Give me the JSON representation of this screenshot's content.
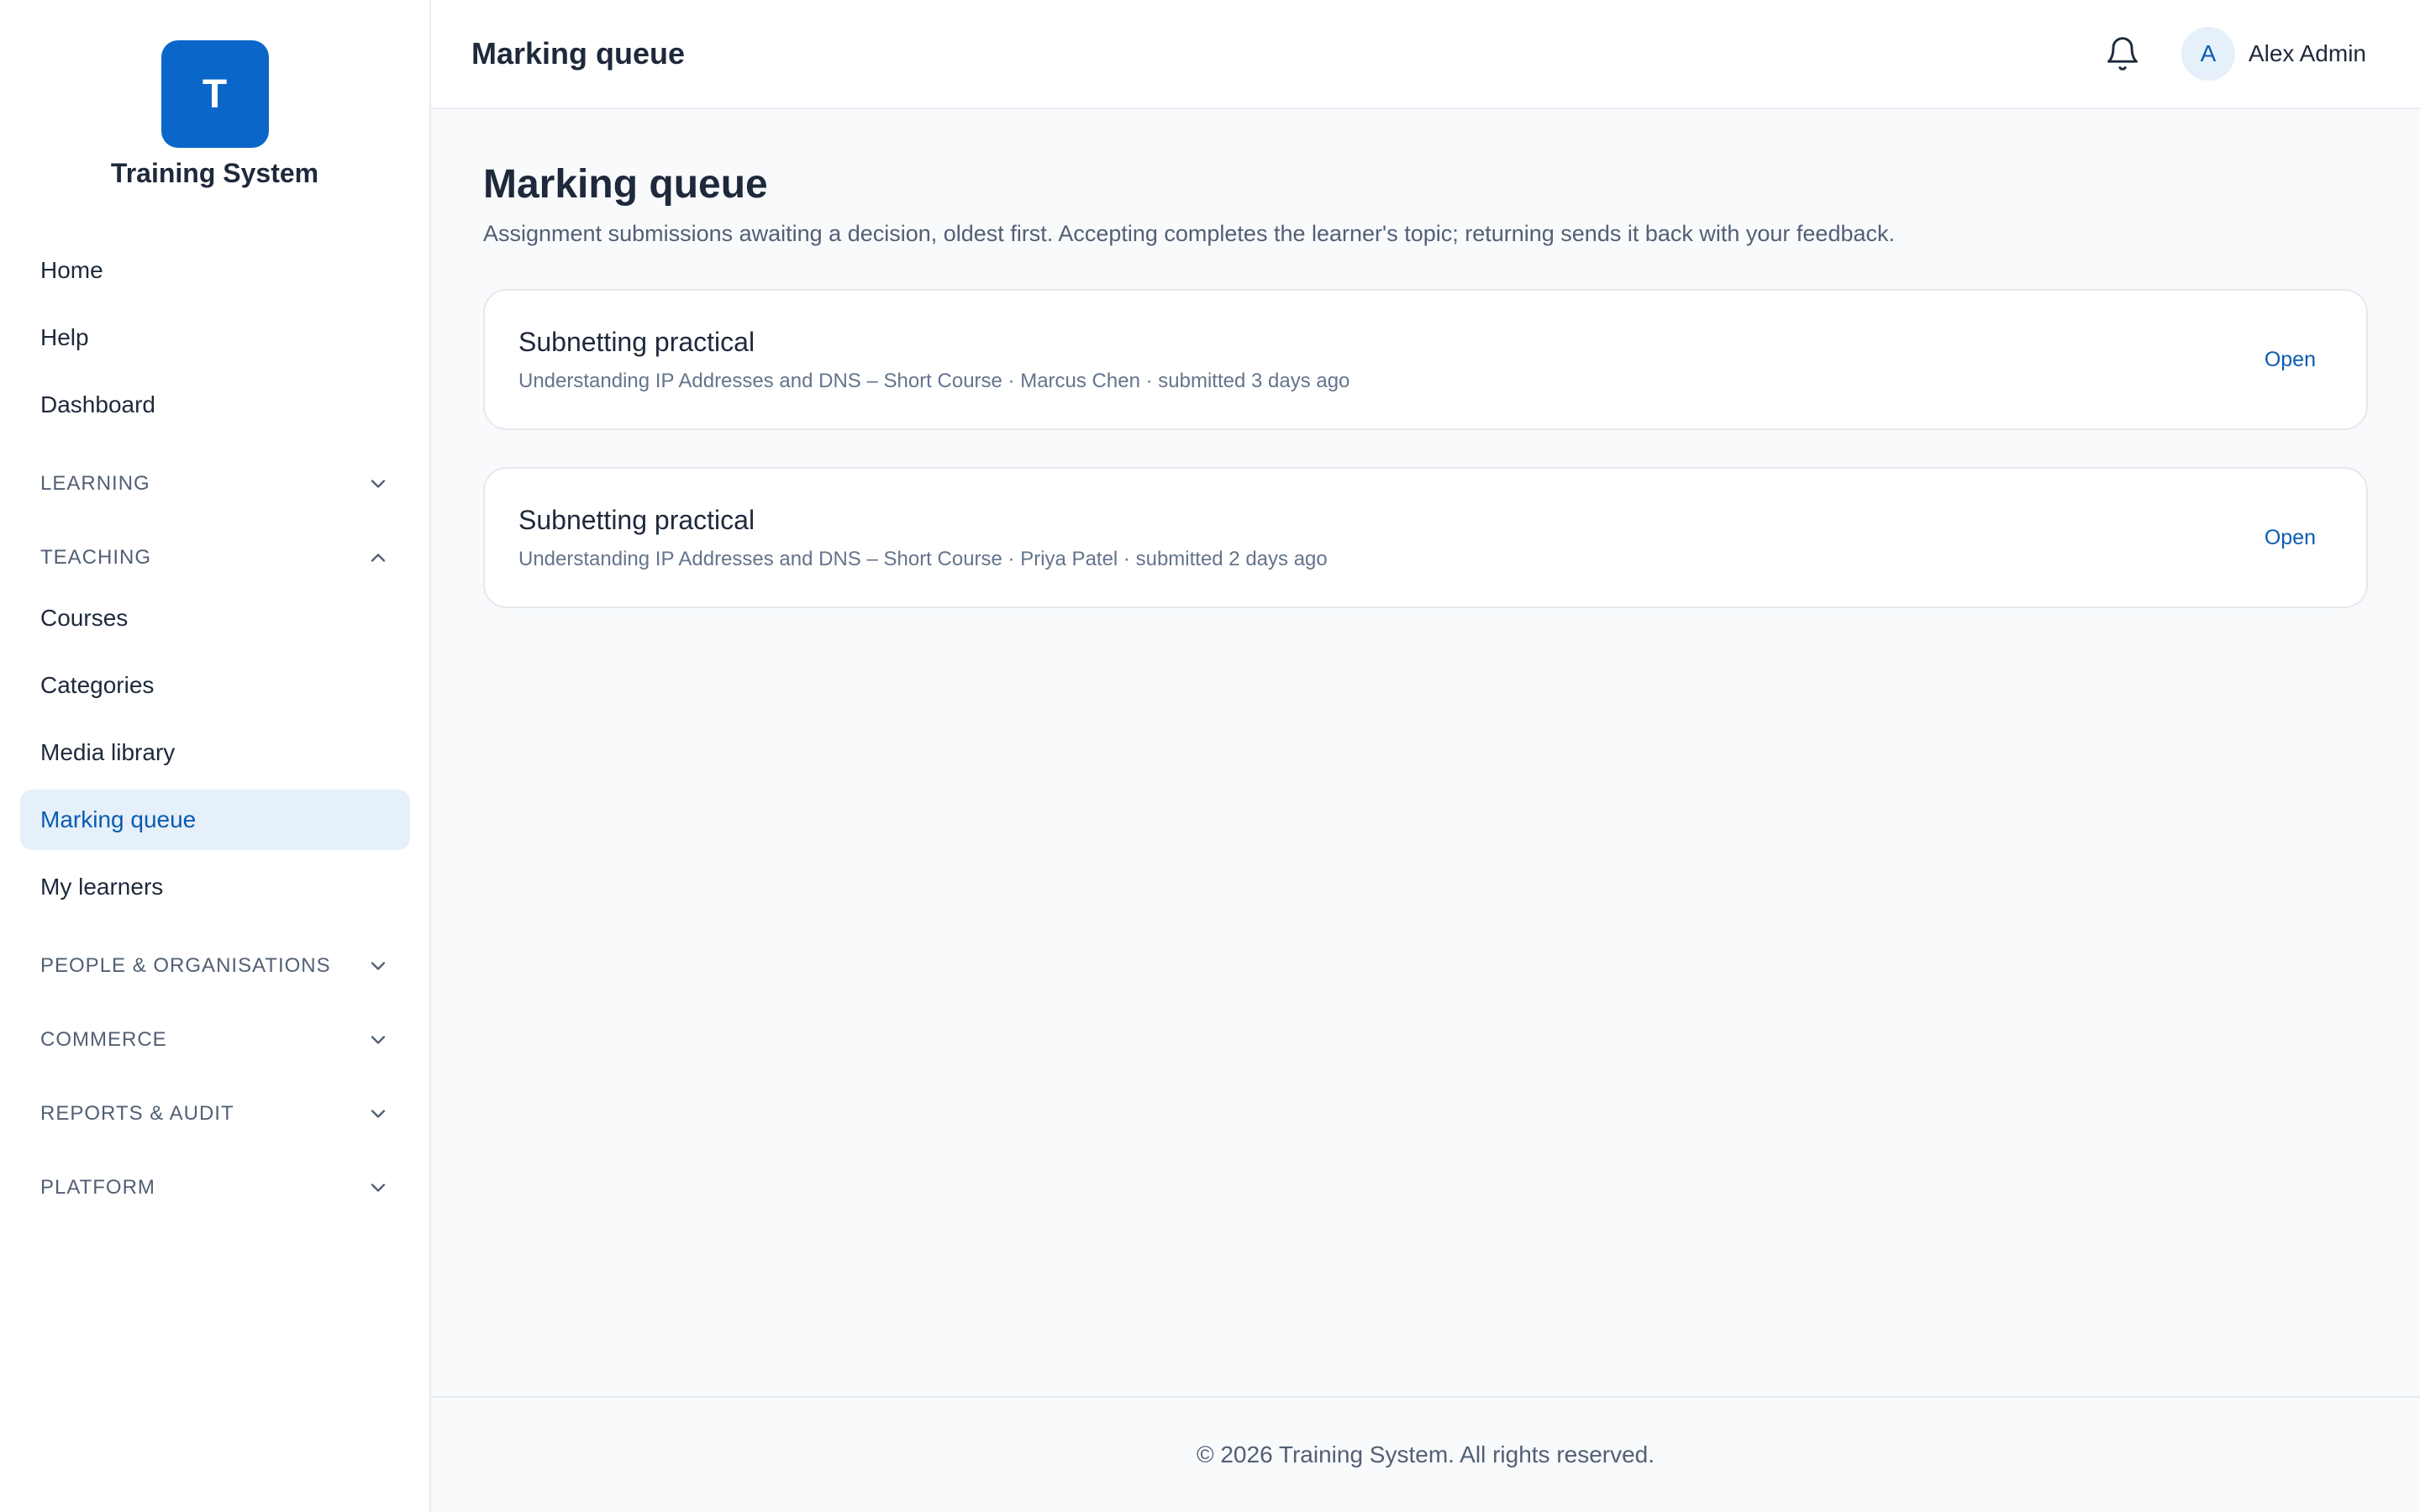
{
  "brand": {
    "logo_letter": "T",
    "name": "Training System"
  },
  "nav": {
    "top": [
      {
        "label": "Home"
      },
      {
        "label": "Help"
      },
      {
        "label": "Dashboard"
      }
    ],
    "sections": {
      "learning": {
        "label": "LEARNING",
        "expanded": false
      },
      "teaching": {
        "label": "TEACHING",
        "expanded": true,
        "items": [
          {
            "label": "Courses"
          },
          {
            "label": "Categories"
          },
          {
            "label": "Media library"
          },
          {
            "label": "Marking queue",
            "active": true
          },
          {
            "label": "My learners"
          }
        ]
      },
      "people": {
        "label": "PEOPLE & ORGANISATIONS",
        "expanded": false
      },
      "commerce": {
        "label": "COMMERCE",
        "expanded": false
      },
      "reports": {
        "label": "REPORTS & AUDIT",
        "expanded": false
      },
      "platform": {
        "label": "PLATFORM",
        "expanded": false
      }
    }
  },
  "header": {
    "title": "Marking queue",
    "bell_icon": "bell-icon",
    "user": {
      "avatar_letter": "A",
      "name": "Alex Admin"
    }
  },
  "main": {
    "title": "Marking queue",
    "description": "Assignment submissions awaiting a decision, oldest first. Accepting completes the learner's topic; returning sends it back with your feedback.",
    "submissions": [
      {
        "title": "Subnetting practical",
        "meta": "Understanding IP Addresses and DNS – Short Course · Marcus Chen · submitted 3 days ago",
        "action": "Open"
      },
      {
        "title": "Subnetting practical",
        "meta": "Understanding IP Addresses and DNS – Short Course · Priya Patel · submitted 2 days ago",
        "action": "Open"
      }
    ]
  },
  "footer": {
    "text": "© 2026 Training System. All rights reserved."
  },
  "colors": {
    "accent": "#0a66c8",
    "active_bg": "#e6f0fa",
    "link": "#0a5cb0"
  }
}
